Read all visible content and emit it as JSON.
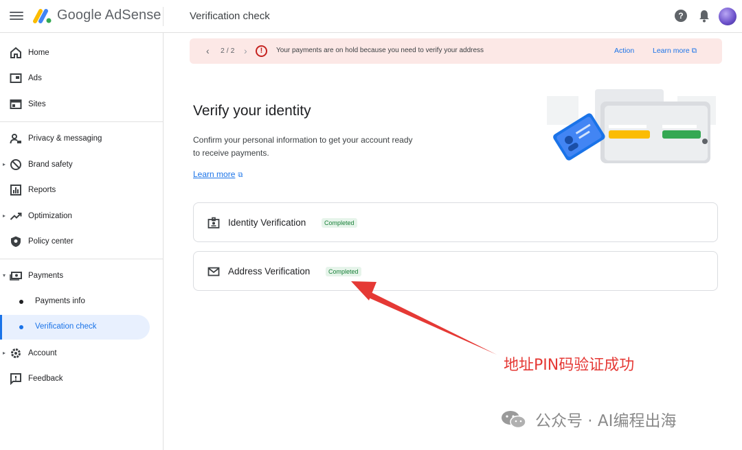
{
  "app": {
    "brand": "Google AdSense",
    "page_title": "Verification check"
  },
  "sidebar": {
    "items": [
      {
        "label": "Home",
        "icon": "home-icon"
      },
      {
        "label": "Ads",
        "icon": "ads-icon"
      },
      {
        "label": "Sites",
        "icon": "sites-icon"
      },
      {
        "label": "Privacy & messaging",
        "icon": "privacy-icon"
      },
      {
        "label": "Brand safety",
        "icon": "block-icon"
      },
      {
        "label": "Reports",
        "icon": "reports-icon"
      },
      {
        "label": "Optimization",
        "icon": "trending-icon"
      },
      {
        "label": "Policy center",
        "icon": "shield-icon"
      },
      {
        "label": "Payments",
        "icon": "payments-icon"
      },
      {
        "label": "Payments info"
      },
      {
        "label": "Verification check"
      },
      {
        "label": "Account",
        "icon": "gear-icon"
      },
      {
        "label": "Feedback",
        "icon": "feedback-icon"
      }
    ]
  },
  "alert": {
    "pager": "2 / 2",
    "message": "Your payments are on hold because you need to verify your address",
    "action": "Action",
    "learn_more": "Learn more"
  },
  "main": {
    "heading": "Verify your identity",
    "description": "Confirm your personal information to get your account ready to receive payments.",
    "learn_more": "Learn more",
    "cards": [
      {
        "title": "Identity Verification",
        "status": "Completed"
      },
      {
        "title": "Address Verification",
        "status": "Completed"
      }
    ]
  },
  "annotation": {
    "text": "地址PIN码验证成功",
    "color": "#e53935"
  },
  "watermark": {
    "text": "公众号 · AI编程出海"
  },
  "colors": {
    "accent": "#1a73e8",
    "alert_bg": "#fce8e6",
    "error": "#c5221f",
    "success": "#188038"
  }
}
